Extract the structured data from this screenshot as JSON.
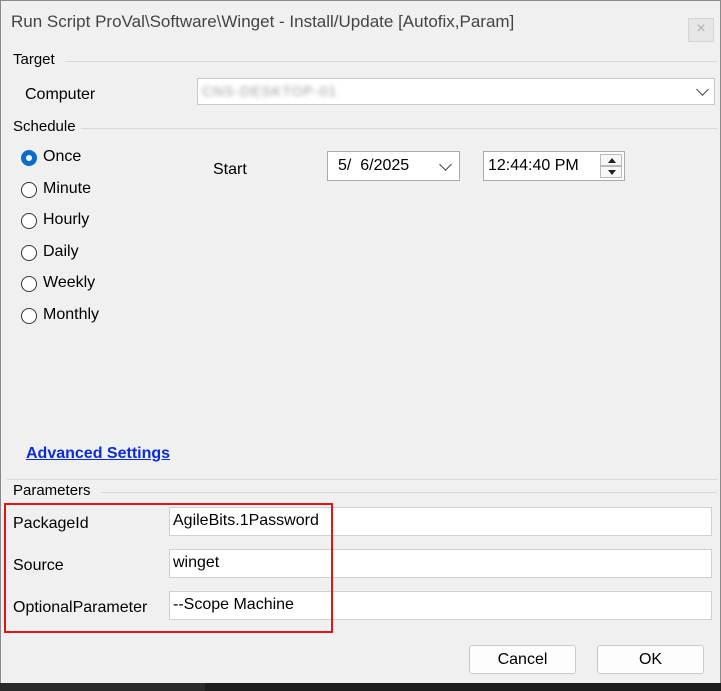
{
  "window": {
    "title": "Run Script ProVal\\Software\\Winget - Install/Update [Autofix,Param]",
    "close_glyph": "×"
  },
  "target": {
    "group_label": "Target",
    "computer_label": "Computer",
    "computer_value": "CNS-DESKTOP-01"
  },
  "schedule": {
    "group_label": "Schedule",
    "options": [
      {
        "label": "Once",
        "checked": true
      },
      {
        "label": "Minute",
        "checked": false
      },
      {
        "label": "Hourly",
        "checked": false
      },
      {
        "label": "Daily",
        "checked": false
      },
      {
        "label": "Weekly",
        "checked": false
      },
      {
        "label": "Monthly",
        "checked": false
      }
    ],
    "start_label": "Start",
    "start_date": "5/  6/2025",
    "start_time": "12:44:40 PM",
    "advanced_link": "Advanced Settings"
  },
  "parameters": {
    "group_label": "Parameters",
    "fields": [
      {
        "label": "PackageId",
        "value": "AgileBits.1Password"
      },
      {
        "label": "Source",
        "value": "winget"
      },
      {
        "label": "OptionalParameter",
        "value": "--Scope Machine"
      }
    ]
  },
  "buttons": {
    "cancel": "Cancel",
    "ok": "OK"
  },
  "colors": {
    "highlight": "#e01616",
    "radio_selected": "#0b6cc9",
    "link": "#0b2bd6"
  }
}
